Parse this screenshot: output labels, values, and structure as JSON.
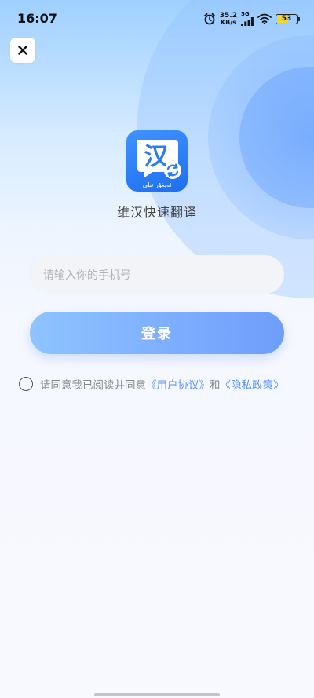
{
  "status_bar": {
    "time": "16:07",
    "net_speed_value": "35.2",
    "net_speed_unit": "KB/s",
    "signal_label": "5G",
    "battery_level": "53",
    "icons": [
      "alarm-icon",
      "signal-icon",
      "wifi-icon",
      "battery-icon"
    ]
  },
  "header": {
    "close_icon": "✕"
  },
  "app": {
    "logo_char": "汉",
    "logo_script": "ئەيغۇر تىلى",
    "name": "维汉快速翻译"
  },
  "form": {
    "phone_placeholder": "请输入你的手机号",
    "login_label": "登录"
  },
  "agreement": {
    "prefix": "请同意我已阅读并同意",
    "user_agreement": "《用户协议》",
    "conjunction": "和",
    "privacy_policy": "《隐私政策》"
  },
  "colors": {
    "accent": "#5b93f0",
    "button_start": "#8ec4ff",
    "button_end": "#6f9dfc",
    "logo_blue": "#2b7cf5",
    "battery_fill": "#f2d531"
  }
}
